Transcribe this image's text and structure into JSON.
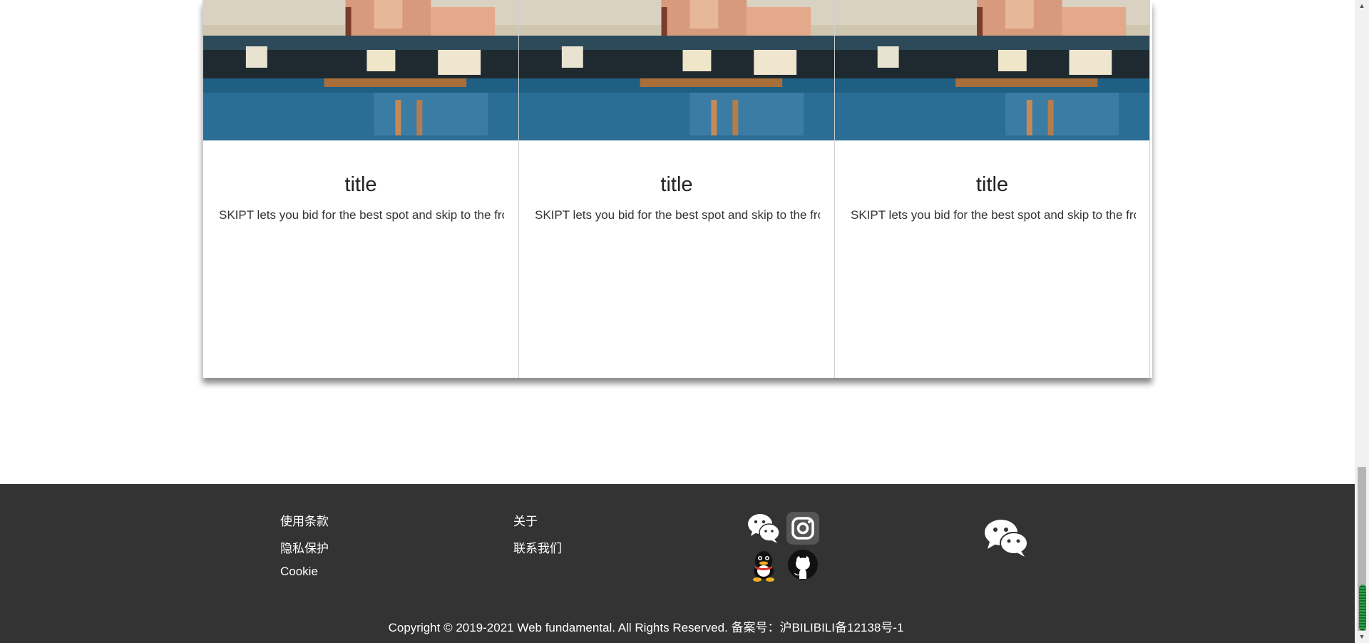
{
  "cards": [
    {
      "image": "atlantis-resort-photo",
      "title": "title",
      "text": "SKIPT lets you bid for the best spot and skip to the front of the queue"
    },
    {
      "image": "atlantis-resort-photo",
      "title": "title",
      "text": "SKIPT lets you bid for the best spot and skip to the front of the queue"
    },
    {
      "image": "atlantis-resort-photo",
      "title": "title",
      "text": "SKIPT lets you bid for the best spot and skip to the front of the queue"
    }
  ],
  "footer": {
    "col1": [
      "使用条款",
      "隐私保护",
      "Cookie"
    ],
    "col2": [
      "关于",
      "联系我们"
    ],
    "social": {
      "icons": [
        "wechat-icon",
        "instagram-icon",
        "qq-icon",
        "github-icon"
      ]
    },
    "qr_icon": "wechat-icon",
    "copyright": "Copyright © 2019-2021 Web fundamental. All Rights Reserved. 备案号：沪BILIBILI备12138号-1"
  },
  "colors": {
    "footer_bg": "#333333",
    "footer_text": "#ffffff",
    "card_title": "#222222",
    "card_text": "#333333"
  }
}
